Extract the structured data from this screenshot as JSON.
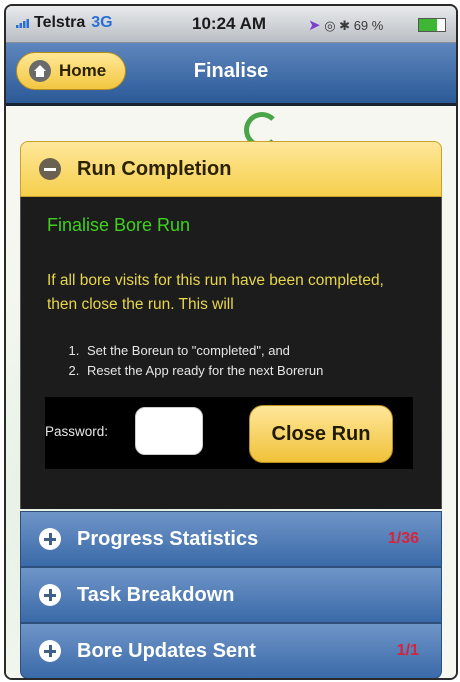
{
  "status_bar": {
    "carrier": "Telstra",
    "network": "3G",
    "time": "10:24 AM",
    "battery": "69 %",
    "battery_level": 0.69
  },
  "nav": {
    "home_label": "Home",
    "title": "Finalise"
  },
  "run_completion": {
    "title": "Run Completion",
    "heading": "Finalise Bore Run",
    "description": "If all bore visits for this run have been completed, then close the run. This will",
    "steps": [
      "Set the Boreun to \"completed\", and",
      "Reset the App ready for the next Borerun"
    ],
    "password_label": "Password:",
    "password_value": "",
    "close_button": "Close Run"
  },
  "sections": [
    {
      "title": "Progress Statistics",
      "count": "1/36"
    },
    {
      "title": "Task Breakdown",
      "count": ""
    },
    {
      "title": "Bore Updates Sent",
      "count": "1/1"
    }
  ],
  "colors": {
    "nav_blue": "#2b5a97",
    "accent_yellow": "#f5cf4c",
    "heading_green": "#3fd21c",
    "desc_yellow": "#e8d64a",
    "count_red": "#d8233a"
  }
}
